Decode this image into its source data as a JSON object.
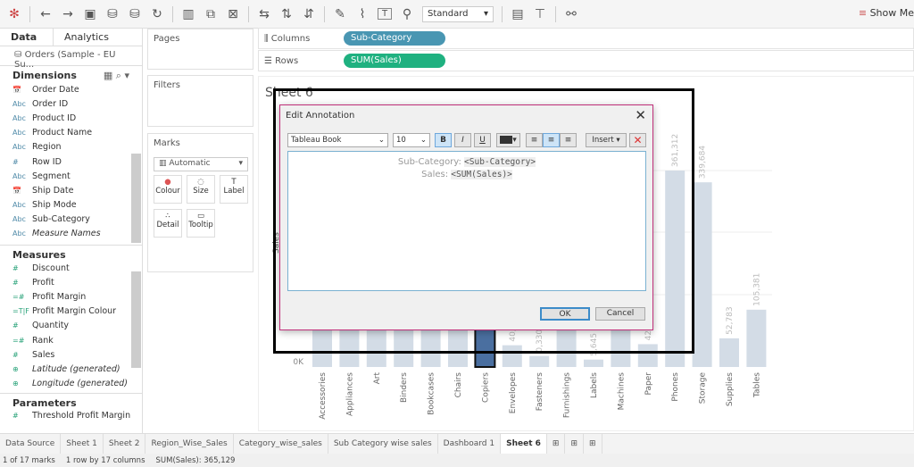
{
  "toolbar": {
    "standard": "Standard",
    "show_me": "Show Me"
  },
  "left": {
    "tab_data": "Data",
    "tab_analytics": "Analytics",
    "datasource": "Orders (Sample - EU Su...",
    "dimensions_title": "Dimensions",
    "dimensions": [
      {
        "icon": "📅",
        "label": "Order Date"
      },
      {
        "icon": "Abc",
        "label": "Order ID"
      },
      {
        "icon": "Abc",
        "label": "Product ID"
      },
      {
        "icon": "Abc",
        "label": "Product Name"
      },
      {
        "icon": "Abc",
        "label": "Region"
      },
      {
        "icon": "#",
        "label": "Row ID"
      },
      {
        "icon": "Abc",
        "label": "Segment"
      },
      {
        "icon": "📅",
        "label": "Ship Date"
      },
      {
        "icon": "Abc",
        "label": "Ship Mode"
      },
      {
        "icon": "Abc",
        "label": "Sub-Category"
      },
      {
        "icon": "Abc",
        "label": "Measure Names",
        "italic": true
      }
    ],
    "measures_title": "Measures",
    "measures": [
      {
        "icon": "#",
        "label": "Discount"
      },
      {
        "icon": "#",
        "label": "Profit"
      },
      {
        "icon": "=#",
        "label": "Profit Margin"
      },
      {
        "icon": "=T|F",
        "label": "Profit Margin Colour"
      },
      {
        "icon": "#",
        "label": "Quantity"
      },
      {
        "icon": "=#",
        "label": "Rank"
      },
      {
        "icon": "#",
        "label": "Sales"
      },
      {
        "icon": "⊕",
        "label": "Latitude (generated)",
        "italic": true
      },
      {
        "icon": "⊕",
        "label": "Longitude (generated)",
        "italic": true
      }
    ],
    "parameters_title": "Parameters",
    "parameters": [
      {
        "icon": "#",
        "label": "Threshold Profit Margin"
      }
    ]
  },
  "cards": {
    "pages": "Pages",
    "filters": "Filters",
    "marks": "Marks",
    "mark_type": "Automatic",
    "colour": "Colour",
    "size": "Size",
    "label": "Label",
    "detail": "Detail",
    "tooltip": "Tooltip"
  },
  "shelves": {
    "columns": "Columns",
    "columns_pill": "Sub-Category",
    "rows": "Rows",
    "rows_pill": "SUM(Sales)",
    "columns_color": "#4996b2",
    "rows_color": "#1fb180"
  },
  "sheet_title": "Sheet 6",
  "dialog": {
    "title": "Edit Annotation",
    "font": "Tableau Book",
    "size": "10",
    "bold": "B",
    "italic": "I",
    "underline": "U",
    "insert": "Insert ▾",
    "line1_label": "Sub-Category: ",
    "line1_token": "<Sub-Category>",
    "line2_label": "Sales: ",
    "line2_token": "<SUM(Sales)>",
    "ok": "OK",
    "cancel": "Cancel"
  },
  "chart_data": {
    "type": "bar",
    "ylabel": "Sales",
    "ytick": "0K",
    "bar_color": "#d3dce6",
    "highlight_color": "#4a6fa0",
    "highlighted": "Copiers",
    "categories": [
      "Accessories",
      "Appliances",
      "Art",
      "Binders",
      "Bookcases",
      "Chairs",
      "Copiers",
      "Envelopes",
      "Fasteners",
      "Furnishings",
      "Labels",
      "Machines",
      "Paper",
      "Phones",
      "Storage",
      "Supplies",
      "Tables"
    ],
    "values": [
      180000,
      230000,
      90000,
      120000,
      250000,
      300000,
      365129,
      40000,
      20330,
      95000,
      13645,
      190000,
      42000,
      361312,
      339684,
      52783,
      105381
    ],
    "labels": [
      "",
      "",
      "",
      "",
      "",
      "",
      "",
      "40,",
      "0,330",
      "",
      "5,645",
      "",
      "42,",
      "361,312",
      "339,684",
      "52,783",
      "105,381"
    ]
  },
  "tabs": [
    "Data Source",
    "Sheet 1",
    "Sheet 2",
    "Region_Wise_Sales",
    "Category_wise_sales",
    "Sub Category wise sales",
    "Dashboard 1",
    "Sheet 6"
  ],
  "status": {
    "marks": "1 of 17 marks",
    "dims": "1 row by 17 columns",
    "sum": "SUM(Sales): 365,129"
  }
}
